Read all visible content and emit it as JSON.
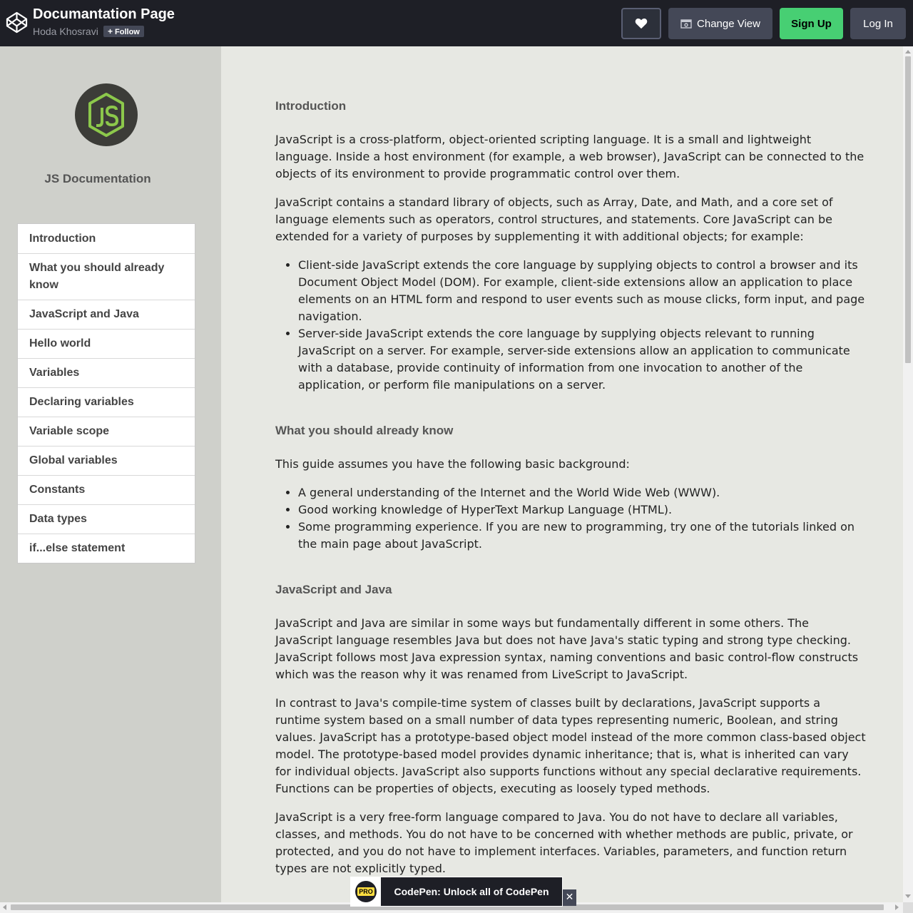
{
  "topbar": {
    "title": "Documantation Page",
    "author": "Hoda Khosravi",
    "follow_label": "Follow",
    "change_view_label": "Change View",
    "signup_label": "Sign Up",
    "login_label": "Log In"
  },
  "sidebar": {
    "title": "JS Documentation",
    "nav": [
      "Introduction",
      "What you should already know",
      "JavaScript and Java",
      "Hello world",
      "Variables",
      "Declaring variables",
      "Variable scope",
      "Global variables",
      "Constants",
      "Data types",
      "if...else statement"
    ]
  },
  "sections": [
    {
      "title": "Introduction",
      "p1": "JavaScript is a cross-platform, object-oriented scripting language. It is a small and lightweight language. Inside a host environment (for example, a web browser), JavaScript can be connected to the objects of its environment to provide programmatic control over them.",
      "p2": "JavaScript contains a standard library of objects, such as Array, Date, and Math, and a core set of language elements such as operators, control structures, and statements. Core JavaScript can be extended for a variety of purposes by supplementing it with additional objects; for example:",
      "list": [
        "Client-side JavaScript extends the core language by supplying objects to control a browser and its Document Object Model (DOM). For example, client-side extensions allow an application to place elements on an HTML form and respond to user events such as mouse clicks, form input, and page navigation.",
        "Server-side JavaScript extends the core language by supplying objects relevant to running JavaScript on a server. For example, server-side extensions allow an application to communicate with a database, provide continuity of information from one invocation to another of the application, or perform file manipulations on a server."
      ]
    },
    {
      "title": "What you should already know",
      "p1": "This guide assumes you have the following basic background:",
      "list": [
        "A general understanding of the Internet and the World Wide Web (WWW).",
        "Good working knowledge of HyperText Markup Language (HTML).",
        "Some programming experience. If you are new to programming, try one of the tutorials linked on the main page about JavaScript."
      ]
    },
    {
      "title": "JavaScript and Java",
      "p1": "JavaScript and Java are similar in some ways but fundamentally different in some others. The JavaScript language resembles Java but does not have Java's static typing and strong type checking. JavaScript follows most Java expression syntax, naming conventions and basic control-flow constructs which was the reason why it was renamed from LiveScript to JavaScript.",
      "p2": "In contrast to Java's compile-time system of classes built by declarations, JavaScript supports a runtime system based on a small number of data types representing numeric, Boolean, and string values. JavaScript has a prototype-based object model instead of the more common class-based object model. The prototype-based model provides dynamic inheritance; that is, what is inherited can vary for individual objects. JavaScript also supports functions without any special declarative requirements. Functions can be properties of objects, executing as loosely typed methods.",
      "p3": "JavaScript is a very free-form language compared to Java. You do not have to declare all variables, classes, and methods. You do not have to be concerned with whether methods are public, private, or protected, and you do not have to implement interfaces. Variables, parameters, and function return types are not explicitly typed."
    }
  ],
  "promo": {
    "badge": "PRO",
    "text": "CodePen: Unlock all of CodePen",
    "close": "✕"
  },
  "colors": {
    "topbar_bg": "#1e1f26",
    "signup_green": "#47cf73",
    "sidebar_bg": "#cfd0cb",
    "main_bg": "#e7e8e3",
    "node_green": "#8cc84b"
  },
  "icons": {
    "logo": "codepen-logo-icon",
    "heart": "heart-icon",
    "view": "change-view-icon",
    "js": "js-hexagon-logo"
  }
}
